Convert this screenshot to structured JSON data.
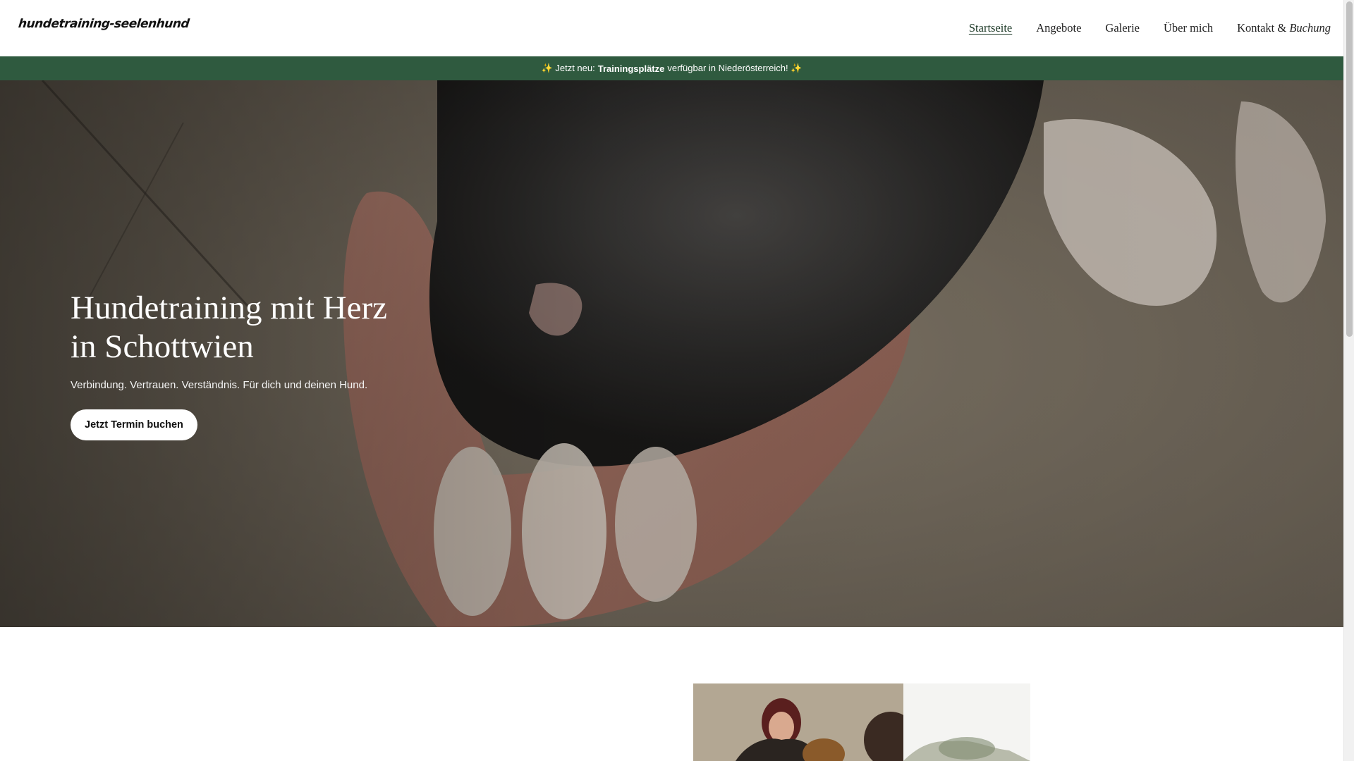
{
  "header": {
    "logo_text": "hundetraining-seelenhund",
    "nav": [
      {
        "label": "Startseite",
        "active": true
      },
      {
        "label": "Angebote"
      },
      {
        "label": "Galerie"
      },
      {
        "label": "Über mich"
      },
      {
        "label_plain": "Kontakt & ",
        "label_italic": "Buchung"
      }
    ]
  },
  "announcement": {
    "prefix": "✨ Jetzt neu:",
    "highlight": "Trainingsplätze",
    "suffix": "verfügbar in Niederösterreich! ✨"
  },
  "hero": {
    "title_line1": "Hundetraining mit Herz",
    "title_line2": "in Schottwien",
    "subtitle": "Verbindung. Vertrauen. Verständnis. Für dich und deinen Hund.",
    "cta_label": "Jetzt Termin buchen"
  },
  "colors": {
    "accent_green": "#2f5a3f",
    "nav_active": "#1e3a28",
    "cta_bg": "#ffffff"
  }
}
